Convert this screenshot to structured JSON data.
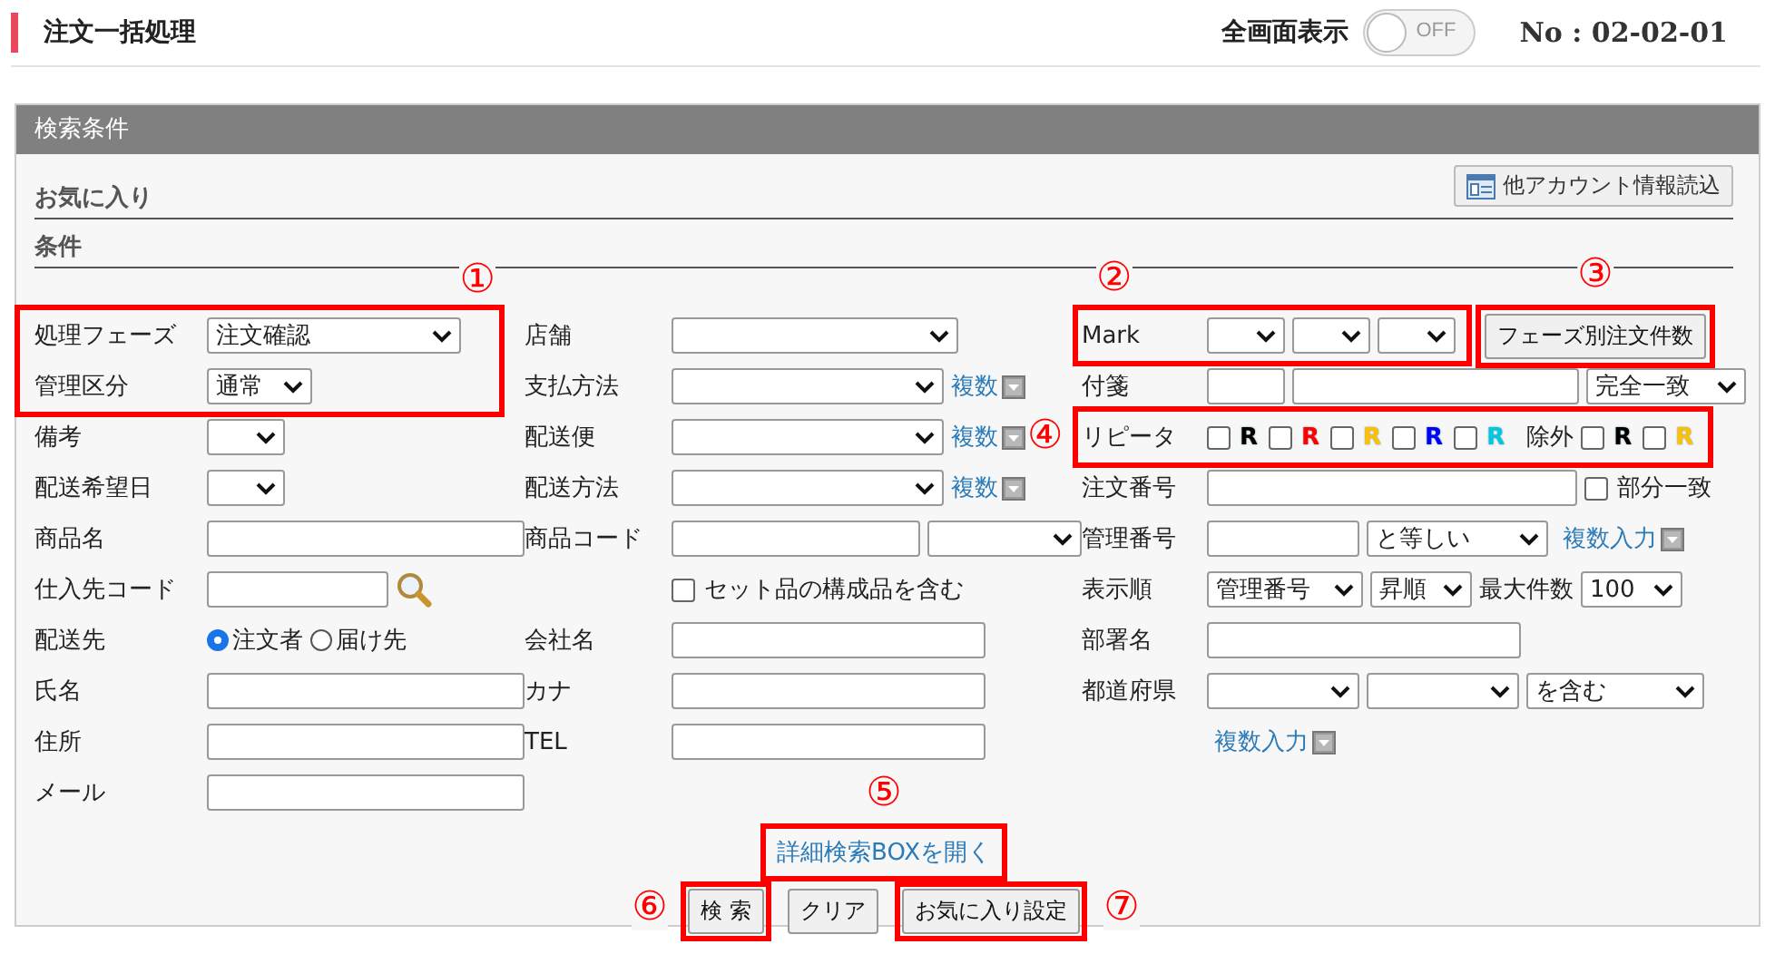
{
  "header": {
    "title": "注文一括処理",
    "fullscreen_label": "全画面表示",
    "fullscreen_toggle": {
      "on": false,
      "label": "OFF"
    },
    "screen_no": "No : 02-02-01"
  },
  "panel": {
    "title": "検索条件",
    "favorites_heading": "お気に入り",
    "load_button": "他アカウント情報読込",
    "conditions_heading": "条件"
  },
  "columns": [
    {
      "items": [
        {
          "kind": "group",
          "callout": "①",
          "rows": [
            {
              "label": "処理フェーズ",
              "controls": [
                {
                  "kind": "select",
                  "value": "注文確認"
                }
              ]
            },
            {
              "label": "管理区分",
              "controls": [
                {
                  "kind": "select",
                  "value": "通常"
                }
              ]
            }
          ]
        },
        {
          "kind": "row",
          "label": "備考",
          "controls": [
            {
              "kind": "select"
            }
          ]
        },
        {
          "kind": "row",
          "label": "配送希望日",
          "controls": [
            {
              "kind": "select"
            }
          ]
        },
        {
          "kind": "row",
          "label": "商品名",
          "controls": [
            {
              "kind": "input"
            }
          ]
        },
        {
          "kind": "row",
          "label": "仕入先コード",
          "controls": [
            {
              "kind": "input"
            },
            {
              "kind": "search-icon"
            }
          ]
        },
        {
          "kind": "row",
          "label": "配送先",
          "controls": [
            {
              "kind": "radio",
              "label": "注文者",
              "selected": true
            },
            {
              "kind": "radio",
              "label": "届け先",
              "selected": false
            }
          ]
        },
        {
          "kind": "row",
          "label": "氏名",
          "controls": [
            {
              "kind": "input"
            }
          ]
        },
        {
          "kind": "row",
          "label": "住所",
          "controls": [
            {
              "kind": "input"
            }
          ]
        },
        {
          "kind": "row",
          "label": "メール",
          "controls": [
            {
              "kind": "input"
            }
          ]
        }
      ]
    },
    {
      "items": [
        {
          "kind": "row",
          "label": "店舗",
          "controls": [
            {
              "kind": "select"
            }
          ]
        },
        {
          "kind": "row",
          "label": "支払方法",
          "controls": [
            {
              "kind": "select"
            },
            {
              "kind": "link",
              "text": "複数"
            }
          ]
        },
        {
          "kind": "row",
          "label": "配送便",
          "controls": [
            {
              "kind": "select"
            },
            {
              "kind": "link",
              "text": "複数"
            }
          ]
        },
        {
          "kind": "row",
          "label": "配送方法",
          "controls": [
            {
              "kind": "select"
            },
            {
              "kind": "link",
              "text": "複数"
            }
          ]
        },
        {
          "kind": "row",
          "label": "商品コード",
          "controls": [
            {
              "kind": "input"
            },
            {
              "kind": "select"
            }
          ]
        },
        {
          "kind": "row",
          "controls": [
            {
              "kind": "checkbox",
              "label": "セット品の構成品を含む",
              "checked": false
            }
          ]
        },
        {
          "kind": "row",
          "label": "会社名",
          "controls": [
            {
              "kind": "input"
            }
          ]
        },
        {
          "kind": "row",
          "label": "カナ",
          "controls": [
            {
              "kind": "input"
            }
          ]
        },
        {
          "kind": "row",
          "label": "TEL",
          "controls": [
            {
              "kind": "input"
            }
          ]
        }
      ]
    },
    {
      "items": [
        {
          "kind": "row",
          "label": "Mark",
          "callout": "②",
          "controls": [
            {
              "kind": "select"
            },
            {
              "kind": "select"
            },
            {
              "kind": "select"
            },
            {
              "kind": "button",
              "text": "フェーズ別注文件数",
              "callout": "③"
            }
          ]
        },
        {
          "kind": "row",
          "label": "付箋",
          "controls": [
            {
              "kind": "input"
            },
            {
              "kind": "input"
            },
            {
              "kind": "select",
              "value": "完全一致"
            }
          ]
        },
        {
          "kind": "row",
          "label": "リピータ",
          "callout": "④",
          "controls": [
            {
              "kind": "checkbox",
              "label": "R",
              "checked": false,
              "color": "#000000"
            },
            {
              "kind": "checkbox",
              "label": "R",
              "checked": false,
              "color": "#ff0000"
            },
            {
              "kind": "checkbox",
              "label": "R",
              "checked": false,
              "color": "#ffc000"
            },
            {
              "kind": "checkbox",
              "label": "R",
              "checked": false,
              "color": "#0000ff"
            },
            {
              "kind": "checkbox",
              "label": "R",
              "checked": false,
              "color": "#00c8e0"
            },
            {
              "kind": "text",
              "text": "除外"
            },
            {
              "kind": "checkbox",
              "label": "R",
              "checked": false,
              "color": "#000000"
            },
            {
              "kind": "checkbox",
              "label": "R",
              "checked": false,
              "color": "#ffc000"
            }
          ]
        },
        {
          "kind": "row",
          "label": "注文番号",
          "controls": [
            {
              "kind": "input"
            },
            {
              "kind": "checkbox",
              "label": "部分一致",
              "checked": false
            }
          ]
        },
        {
          "kind": "row",
          "label": "管理番号",
          "controls": [
            {
              "kind": "input"
            },
            {
              "kind": "select",
              "value": "と等しい"
            },
            {
              "kind": "link",
              "text": "複数入力"
            }
          ]
        },
        {
          "kind": "row",
          "label": "表示順",
          "controls": [
            {
              "kind": "select",
              "value": "管理番号"
            },
            {
              "kind": "select",
              "value": "昇順"
            },
            {
              "kind": "text",
              "text": "最大件数"
            },
            {
              "kind": "select",
              "value": "100"
            }
          ]
        },
        {
          "kind": "row",
          "label": "部署名",
          "controls": [
            {
              "kind": "input"
            }
          ]
        },
        {
          "kind": "row",
          "label": "都道府県",
          "controls": [
            {
              "kind": "select"
            },
            {
              "kind": "select"
            },
            {
              "kind": "select",
              "value": "を含む"
            }
          ]
        },
        {
          "kind": "row",
          "controls": [
            {
              "kind": "link",
              "text": "複数入力"
            }
          ]
        }
      ]
    }
  ],
  "detail_link": {
    "text": "詳細検索BOXを開く",
    "callout": "⑤"
  },
  "buttons": [
    {
      "text": "検 索",
      "callout": "⑥"
    },
    {
      "text": "クリア"
    },
    {
      "text": "お気に入り設定",
      "callout": "⑦"
    }
  ]
}
